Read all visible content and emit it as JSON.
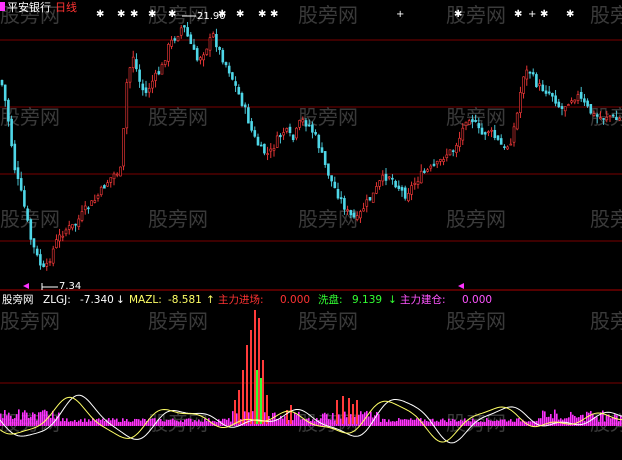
{
  "header": {
    "stock_name": "平安银行",
    "period": "日线",
    "high_price": "21.90",
    "low_price": "7.34"
  },
  "watermark": "股旁网",
  "indicator": {
    "name": "股旁网",
    "zlgj_label": "ZLGJ:",
    "zlgj_value": "-7.340",
    "zlgj_arrow": "↓",
    "mazl_label": "MAZL:",
    "mazl_value": "-8.581",
    "mazl_arrow": "↑",
    "zljc_label": "主力进场:",
    "zljc_value": "0.000",
    "xp_label": "洗盘:",
    "xp_value": "9.139",
    "xp_arrow": "↓",
    "zljc2_label": "主力建仓:",
    "zljc2_value": "0.000"
  },
  "colors": {
    "up": "#ff3b3b",
    "down": "#4fd7e8",
    "grid": "#8b0000",
    "zlgj": "#ffffff",
    "mazl": "#ffff66",
    "magenta": "#ff33ff",
    "green": "#33ff33",
    "label_white": "#ffffff",
    "label_red": "#ff3333"
  }
}
